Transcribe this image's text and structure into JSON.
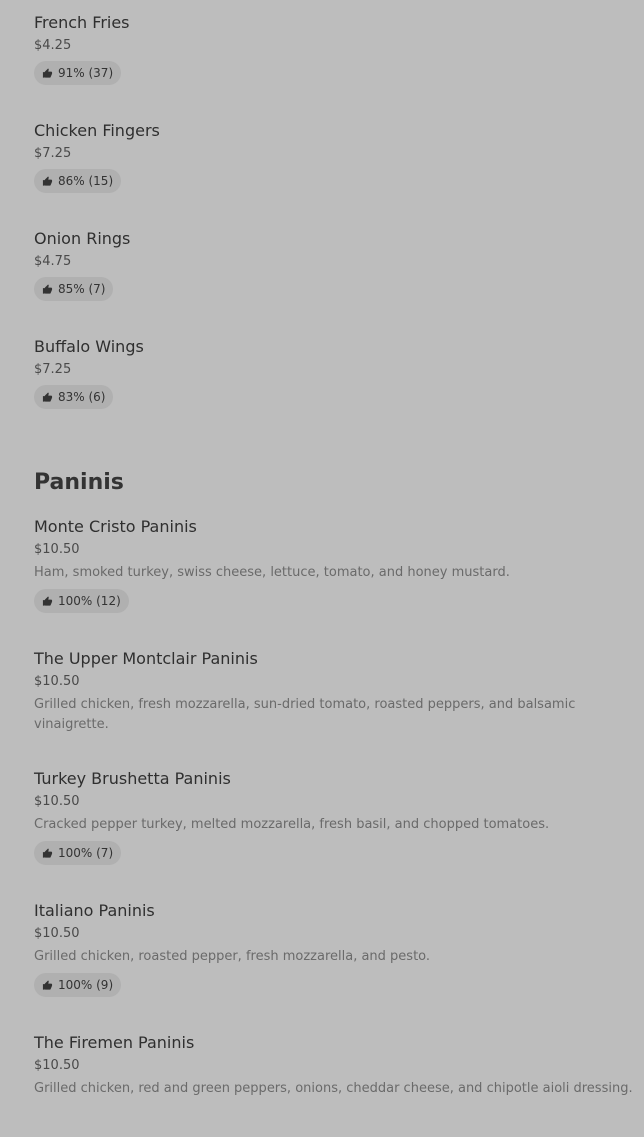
{
  "sides": [
    {
      "name": "French Fries",
      "price": "$4.25",
      "rating": "91% (37)"
    },
    {
      "name": "Chicken Fingers",
      "price": "$7.25",
      "rating": "86% (15)"
    },
    {
      "name": "Onion Rings",
      "price": "$4.75",
      "rating": "85% (7)"
    },
    {
      "name": "Buffalo Wings",
      "price": "$7.25",
      "rating": "83% (6)"
    }
  ],
  "paninis": {
    "title": "Paninis",
    "items": [
      {
        "name": "Monte Cristo Paninis",
        "price": "$10.50",
        "desc": "Ham, smoked turkey, swiss cheese, lettuce, tomato, and honey mustard.",
        "rating": "100% (12)"
      },
      {
        "name": "The Upper Montclair Paninis",
        "price": "$10.50",
        "desc": "Grilled chicken, fresh mozzarella, sun-dried tomato, roasted peppers, and balsamic vinaigrette.",
        "rating": ""
      },
      {
        "name": "Turkey Brushetta Paninis",
        "price": "$10.50",
        "desc": "Cracked pepper turkey, melted mozzarella, fresh basil, and chopped tomatoes.",
        "rating": "100% (7)"
      },
      {
        "name": "Italiano Paninis",
        "price": "$10.50",
        "desc": "Grilled chicken, roasted pepper, fresh mozzarella, and pesto.",
        "rating": "100% (9)"
      },
      {
        "name": "The Firemen Paninis",
        "price": "$10.50",
        "desc": "Grilled chicken, red and green peppers, onions, cheddar cheese, and chipotle aioli dressing.",
        "rating": ""
      }
    ]
  },
  "icons": {
    "rating_icon": "thumbs-up-icon"
  }
}
